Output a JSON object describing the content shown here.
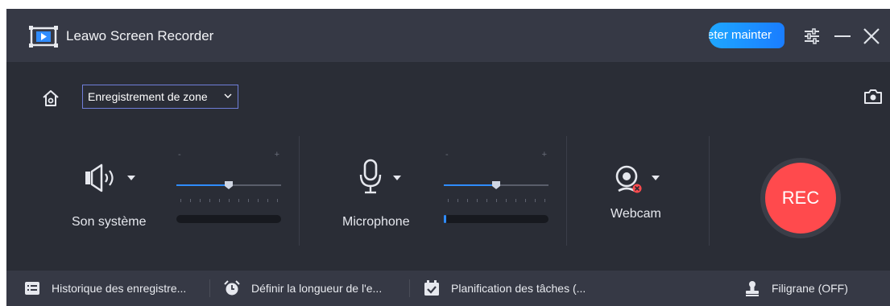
{
  "app": {
    "title": "Leawo Screen Recorder",
    "buy_button_label": "eter mainter"
  },
  "toolbar": {
    "mode_select_value": "Enregistrement de zone"
  },
  "audio_system": {
    "label": "Son système",
    "slider_minus": "-",
    "slider_plus": "+",
    "volume_fraction": 0.5,
    "level_fraction": 0.0
  },
  "microphone": {
    "label": "Microphone",
    "slider_minus": "-",
    "slider_plus": "+",
    "volume_fraction": 0.5,
    "level_fraction": 0.02
  },
  "webcam": {
    "label": "Webcam",
    "status": "off"
  },
  "record": {
    "label": "REC"
  },
  "statusbar": {
    "history_label": "Historique des enregistre...",
    "duration_label": "Définir la longueur de l'e...",
    "schedule_label": "Planification des tâches (...",
    "watermark_label": "Filigrane (OFF)"
  },
  "colors": {
    "accent": "#2f8cff",
    "rec": "#ff4a4d",
    "background": "#2a2d36",
    "titlebar": "#363945"
  },
  "icons": [
    "app-logo-icon",
    "settings-sliders-icon",
    "minimize-icon",
    "close-icon",
    "home-icon",
    "camera-snapshot-icon",
    "speaker-icon",
    "microphone-icon",
    "webcam-icon",
    "history-list-icon",
    "alarm-clock-icon",
    "calendar-check-icon",
    "user-stamp-icon"
  ]
}
